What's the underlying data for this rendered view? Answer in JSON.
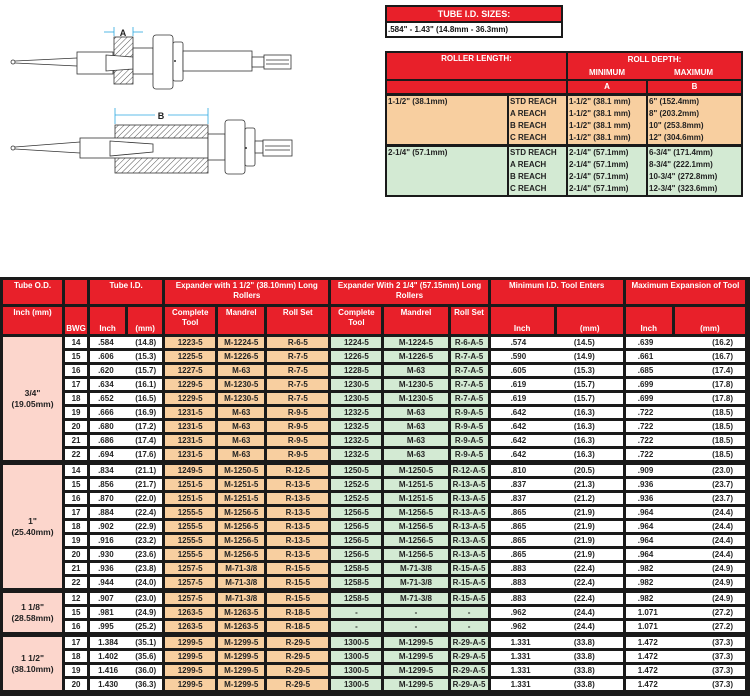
{
  "diagram": {
    "label_a": "A",
    "label_b": "B"
  },
  "tube_id_sizes": {
    "header": "TUBE I.D. SIZES:",
    "value": ".584\" - 1.43\" (14.8mm - 36.3mm)"
  },
  "roll_depth": {
    "roller_length_header": "ROLLER LENGTH:",
    "roll_depth_header": "ROLL DEPTH:",
    "minimum_header": "MINIMUM",
    "maximum_header": "MAXIMUM",
    "col_a": "A",
    "col_b": "B",
    "groups": [
      {
        "length": "1-1/2\" (38.1mm)",
        "rows": [
          {
            "reach": "STD REACH",
            "min": "1-1/2\" (38.1 mm)",
            "max": "6\" (152.4mm)"
          },
          {
            "reach": "A REACH",
            "min": "1-1/2\" (38.1 mm)",
            "max": "8\" (203.2mm)"
          },
          {
            "reach": "B REACH",
            "min": "1-1/2\" (38.1 mm)",
            "max": "10\" (253.8mm)"
          },
          {
            "reach": "C REACH",
            "min": "1-1/2\" (38.1 mm)",
            "max": "12\" (304.6mm)"
          }
        ]
      },
      {
        "length": "2-1/4\" (57.1mm)",
        "rows": [
          {
            "reach": "STD REACH",
            "min": "2-1/4\" (57.1mm)",
            "max": "6-3/4\" (171.4mm)"
          },
          {
            "reach": "A REACH",
            "min": "2-1/4\" (57.1mm)",
            "max": "8-3/4\" (222.1mm)"
          },
          {
            "reach": "B REACH",
            "min": "2-1/4\" (57.1mm)",
            "max": "10-3/4\" (272.8mm)"
          },
          {
            "reach": "C REACH",
            "min": "2-1/4\" (57.1mm)",
            "max": "12-3/4\" (323.6mm)"
          }
        ]
      }
    ]
  },
  "main_table": {
    "headers": {
      "tube_od": "Tube O.D.",
      "tube_id": "Tube I.D.",
      "exp_15": "Expander with 1 1/2\" (38.10mm) Long Rollers",
      "exp_225": "Expander With 2 1/4\" (57.15mm) Long Rollers",
      "min_id": "Minimum I.D. Tool Enters",
      "max_exp": "Maximum Expansion of Tool",
      "inch_mm": "Inch (mm)",
      "bwg": "BWG",
      "inch": "Inch",
      "mm": "(mm)",
      "complete_tool": "Complete Tool",
      "mandrel": "Mandrel",
      "roll_set": "Roll Set"
    },
    "groups": [
      {
        "od_inch": "3/4\"",
        "od_mm": "(19.05mm)",
        "rows": [
          {
            "bwg": "14",
            "id_in": ".584",
            "id_mm": "(14.8)",
            "t1": "1223-5",
            "m1": "M-1224-5",
            "r1": "R-6-5",
            "t2": "1224-5",
            "m2": "M-1224-5",
            "r2": "R-6-A-5",
            "min_in": ".574",
            "min_mm": "(14.5)",
            "max_in": ".639",
            "max_mm": "(16.2)"
          },
          {
            "bwg": "15",
            "id_in": ".606",
            "id_mm": "(15.3)",
            "t1": "1225-5",
            "m1": "M-1226-5",
            "r1": "R-7-5",
            "t2": "1226-5",
            "m2": "M-1226-5",
            "r2": "R-7-A-5",
            "min_in": ".590",
            "min_mm": "(14.9)",
            "max_in": ".661",
            "max_mm": "(16.7)"
          },
          {
            "bwg": "16",
            "id_in": ".620",
            "id_mm": "(15.7)",
            "t1": "1227-5",
            "m1": "M-63",
            "r1": "R-7-5",
            "t2": "1228-5",
            "m2": "M-63",
            "r2": "R-7-A-5",
            "min_in": ".605",
            "min_mm": "(15.3)",
            "max_in": ".685",
            "max_mm": "(17.4)"
          },
          {
            "bwg": "17",
            "id_in": ".634",
            "id_mm": "(16.1)",
            "t1": "1229-5",
            "m1": "M-1230-5",
            "r1": "R-7-5",
            "t2": "1230-5",
            "m2": "M-1230-5",
            "r2": "R-7-A-5",
            "min_in": ".619",
            "min_mm": "(15.7)",
            "max_in": ".699",
            "max_mm": "(17.8)"
          },
          {
            "bwg": "18",
            "id_in": ".652",
            "id_mm": "(16.5)",
            "t1": "1229-5",
            "m1": "M-1230-5",
            "r1": "R-7-5",
            "t2": "1230-5",
            "m2": "M-1230-5",
            "r2": "R-7-A-5",
            "min_in": ".619",
            "min_mm": "(15.7)",
            "max_in": ".699",
            "max_mm": "(17.8)"
          },
          {
            "bwg": "19",
            "id_in": ".666",
            "id_mm": "(16.9)",
            "t1": "1231-5",
            "m1": "M-63",
            "r1": "R-9-5",
            "t2": "1232-5",
            "m2": "M-63",
            "r2": "R-9-A-5",
            "min_in": ".642",
            "min_mm": "(16.3)",
            "max_in": ".722",
            "max_mm": "(18.5)"
          },
          {
            "bwg": "20",
            "id_in": ".680",
            "id_mm": "(17.2)",
            "t1": "1231-5",
            "m1": "M-63",
            "r1": "R-9-5",
            "t2": "1232-5",
            "m2": "M-63",
            "r2": "R-9-A-5",
            "min_in": ".642",
            "min_mm": "(16.3)",
            "max_in": ".722",
            "max_mm": "(18.5)"
          },
          {
            "bwg": "21",
            "id_in": ".686",
            "id_mm": "(17.4)",
            "t1": "1231-5",
            "m1": "M-63",
            "r1": "R-9-5",
            "t2": "1232-5",
            "m2": "M-63",
            "r2": "R-9-A-5",
            "min_in": ".642",
            "min_mm": "(16.3)",
            "max_in": ".722",
            "max_mm": "(18.5)"
          },
          {
            "bwg": "22",
            "id_in": ".694",
            "id_mm": "(17.6)",
            "t1": "1231-5",
            "m1": "M-63",
            "r1": "R-9-5",
            "t2": "1232-5",
            "m2": "M-63",
            "r2": "R-9-A-5",
            "min_in": ".642",
            "min_mm": "(16.3)",
            "max_in": ".722",
            "max_mm": "(18.5)"
          }
        ]
      },
      {
        "od_inch": "1\"",
        "od_mm": "(25.40mm)",
        "rows": [
          {
            "bwg": "14",
            "id_in": ".834",
            "id_mm": "(21.1)",
            "t1": "1249-5",
            "m1": "M-1250-5",
            "r1": "R-12-5",
            "t2": "1250-5",
            "m2": "M-1250-5",
            "r2": "R-12-A-5",
            "min_in": ".810",
            "min_mm": "(20.5)",
            "max_in": ".909",
            "max_mm": "(23.0)"
          },
          {
            "bwg": "15",
            "id_in": ".856",
            "id_mm": "(21.7)",
            "t1": "1251-5",
            "m1": "M-1251-5",
            "r1": "R-13-5",
            "t2": "1252-5",
            "m2": "M-1251-5",
            "r2": "R-13-A-5",
            "min_in": ".837",
            "min_mm": "(21.3)",
            "max_in": ".936",
            "max_mm": "(23.7)"
          },
          {
            "bwg": "16",
            "id_in": ".870",
            "id_mm": "(22.0)",
            "t1": "1251-5",
            "m1": "M-1251-5",
            "r1": "R-13-5",
            "t2": "1252-5",
            "m2": "M-1251-5",
            "r2": "R-13-A-5",
            "min_in": ".837",
            "min_mm": "(21.2)",
            "max_in": ".936",
            "max_mm": "(23.7)"
          },
          {
            "bwg": "17",
            "id_in": ".884",
            "id_mm": "(22.4)",
            "t1": "1255-5",
            "m1": "M-1256-5",
            "r1": "R-13-5",
            "t2": "1256-5",
            "m2": "M-1256-5",
            "r2": "R-13-A-5",
            "min_in": ".865",
            "min_mm": "(21.9)",
            "max_in": ".964",
            "max_mm": "(24.4)"
          },
          {
            "bwg": "18",
            "id_in": ".902",
            "id_mm": "(22.9)",
            "t1": "1255-5",
            "m1": "M-1256-5",
            "r1": "R-13-5",
            "t2": "1256-5",
            "m2": "M-1256-5",
            "r2": "R-13-A-5",
            "min_in": ".865",
            "min_mm": "(21.9)",
            "max_in": ".964",
            "max_mm": "(24.4)"
          },
          {
            "bwg": "19",
            "id_in": ".916",
            "id_mm": "(23.2)",
            "t1": "1255-5",
            "m1": "M-1256-5",
            "r1": "R-13-5",
            "t2": "1256-5",
            "m2": "M-1256-5",
            "r2": "R-13-A-5",
            "min_in": ".865",
            "min_mm": "(21.9)",
            "max_in": ".964",
            "max_mm": "(24.4)"
          },
          {
            "bwg": "20",
            "id_in": ".930",
            "id_mm": "(23.6)",
            "t1": "1255-5",
            "m1": "M-1256-5",
            "r1": "R-13-5",
            "t2": "1256-5",
            "m2": "M-1256-5",
            "r2": "R-13-A-5",
            "min_in": ".865",
            "min_mm": "(21.9)",
            "max_in": ".964",
            "max_mm": "(24.4)"
          },
          {
            "bwg": "21",
            "id_in": ".936",
            "id_mm": "(23.8)",
            "t1": "1257-5",
            "m1": "M-71-3/8",
            "r1": "R-15-5",
            "t2": "1258-5",
            "m2": "M-71-3/8",
            "r2": "R-15-A-5",
            "min_in": ".883",
            "min_mm": "(22.4)",
            "max_in": ".982",
            "max_mm": "(24.9)"
          },
          {
            "bwg": "22",
            "id_in": ".944",
            "id_mm": "(24.0)",
            "t1": "1257-5",
            "m1": "M-71-3/8",
            "r1": "R-15-5",
            "t2": "1258-5",
            "m2": "M-71-3/8",
            "r2": "R-15-A-5",
            "min_in": ".883",
            "min_mm": "(22.4)",
            "max_in": ".982",
            "max_mm": "(24.9)"
          }
        ]
      },
      {
        "od_inch": "1 1/8\"",
        "od_mm": "(28.58mm)",
        "rows": [
          {
            "bwg": "12",
            "id_in": ".907",
            "id_mm": "(23.0)",
            "t1": "1257-5",
            "m1": "M-71-3/8",
            "r1": "R-15-5",
            "t2": "1258-5",
            "m2": "M-71-3/8",
            "r2": "R-15-A-5",
            "min_in": ".883",
            "min_mm": "(22.4)",
            "max_in": ".982",
            "max_mm": "(24.9)"
          },
          {
            "bwg": "15",
            "id_in": ".981",
            "id_mm": "(24.9)",
            "t1": "1263-5",
            "m1": "M-1263-5",
            "r1": "R-18-5",
            "t2": "-",
            "m2": "-",
            "r2": "-",
            "min_in": ".962",
            "min_mm": "(24.4)",
            "max_in": "1.071",
            "max_mm": "(27.2)"
          },
          {
            "bwg": "16",
            "id_in": ".995",
            "id_mm": "(25.2)",
            "t1": "1263-5",
            "m1": "M-1263-5",
            "r1": "R-18-5",
            "t2": "-",
            "m2": "-",
            "r2": "-",
            "min_in": ".962",
            "min_mm": "(24.4)",
            "max_in": "1.071",
            "max_mm": "(27.2)"
          }
        ]
      },
      {
        "od_inch": "1 1/2\"",
        "od_mm": "(38.10mm)",
        "rows": [
          {
            "bwg": "17",
            "id_in": "1.384",
            "id_mm": "(35.1)",
            "t1": "1299-5",
            "m1": "M-1299-5",
            "r1": "R-29-5",
            "t2": "1300-5",
            "m2": "M-1299-5",
            "r2": "R-29-A-5",
            "min_in": "1.331",
            "min_mm": "(33.8)",
            "max_in": "1.472",
            "max_mm": "(37.3)"
          },
          {
            "bwg": "18",
            "id_in": "1.402",
            "id_mm": "(35.6)",
            "t1": "1299-5",
            "m1": "M-1299-5",
            "r1": "R-29-5",
            "t2": "1300-5",
            "m2": "M-1299-5",
            "r2": "R-29-A-5",
            "min_in": "1.331",
            "min_mm": "(33.8)",
            "max_in": "1.472",
            "max_mm": "(37.3)"
          },
          {
            "bwg": "19",
            "id_in": "1.416",
            "id_mm": "(36.0)",
            "t1": "1299-5",
            "m1": "M-1299-5",
            "r1": "R-29-5",
            "t2": "1300-5",
            "m2": "M-1299-5",
            "r2": "R-29-A-5",
            "min_in": "1.331",
            "min_mm": "(33.8)",
            "max_in": "1.472",
            "max_mm": "(37.3)"
          },
          {
            "bwg": "20",
            "id_in": "1.430",
            "id_mm": "(36.3)",
            "t1": "1299-5",
            "m1": "M-1299-5",
            "r1": "R-29-5",
            "t2": "1300-5",
            "m2": "M-1299-5",
            "r2": "R-29-A-5",
            "min_in": "1.331",
            "min_mm": "(33.8)",
            "max_in": "1.472",
            "max_mm": "(37.3)"
          }
        ]
      }
    ]
  },
  "colors": {
    "header_red": "#e8202a",
    "orange_fill": "#f8cfa0",
    "green_fill": "#d3ead3",
    "pink_fill": "#fcd6cc",
    "dimension_blue": "#2aa8e0"
  }
}
